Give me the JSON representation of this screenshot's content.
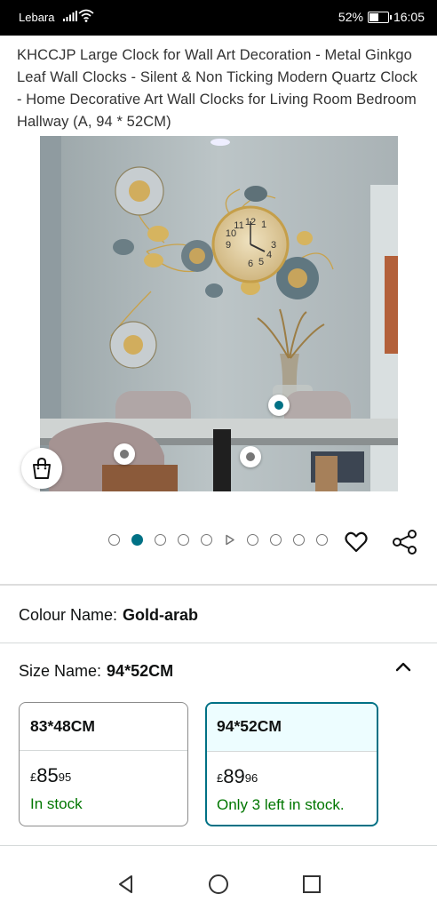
{
  "status_bar": {
    "carrier": "Lebara",
    "battery": "52%",
    "battery_level": 0.52,
    "time": "16:05"
  },
  "product": {
    "title": "KHCCJP Large Clock for Wall Art Decoration - Metal Ginkgo Leaf Wall Clocks - Silent & Non Ticking Modern Quartz Clock - Home Decorative Art Wall Clocks for Living Room Bedroom Hallway (A, 94 * 52CM)"
  },
  "gallery": {
    "total_slides": 10,
    "active_index": 1,
    "video_index": 5,
    "clock_numerals": [
      "12",
      "1",
      "3",
      "4",
      "5",
      "6",
      "9",
      "10",
      "11"
    ]
  },
  "colour": {
    "label": "Colour Name:",
    "value": "Gold-arab"
  },
  "size": {
    "label": "Size Name:",
    "value": "94*52CM",
    "options": [
      {
        "name": "83*48CM",
        "currency": "£",
        "price_whole": "85",
        "price_fraction": "95",
        "stock": "In stock",
        "selected": false
      },
      {
        "name": "94*52CM",
        "currency": "£",
        "price_whole": "89",
        "price_fraction": "96",
        "stock": "Only 3 left in stock.",
        "selected": true
      }
    ]
  },
  "icons": {
    "wishlist": "heart-icon",
    "share": "share-icon",
    "cart": "shopping-bag-icon",
    "collapse": "chevron-up-icon",
    "back": "back-triangle-icon",
    "home": "home-circle-icon",
    "recents": "recents-square-icon"
  },
  "colors": {
    "accent": "#007185",
    "stock": "#007600",
    "selected_bg": "#edfdff"
  }
}
